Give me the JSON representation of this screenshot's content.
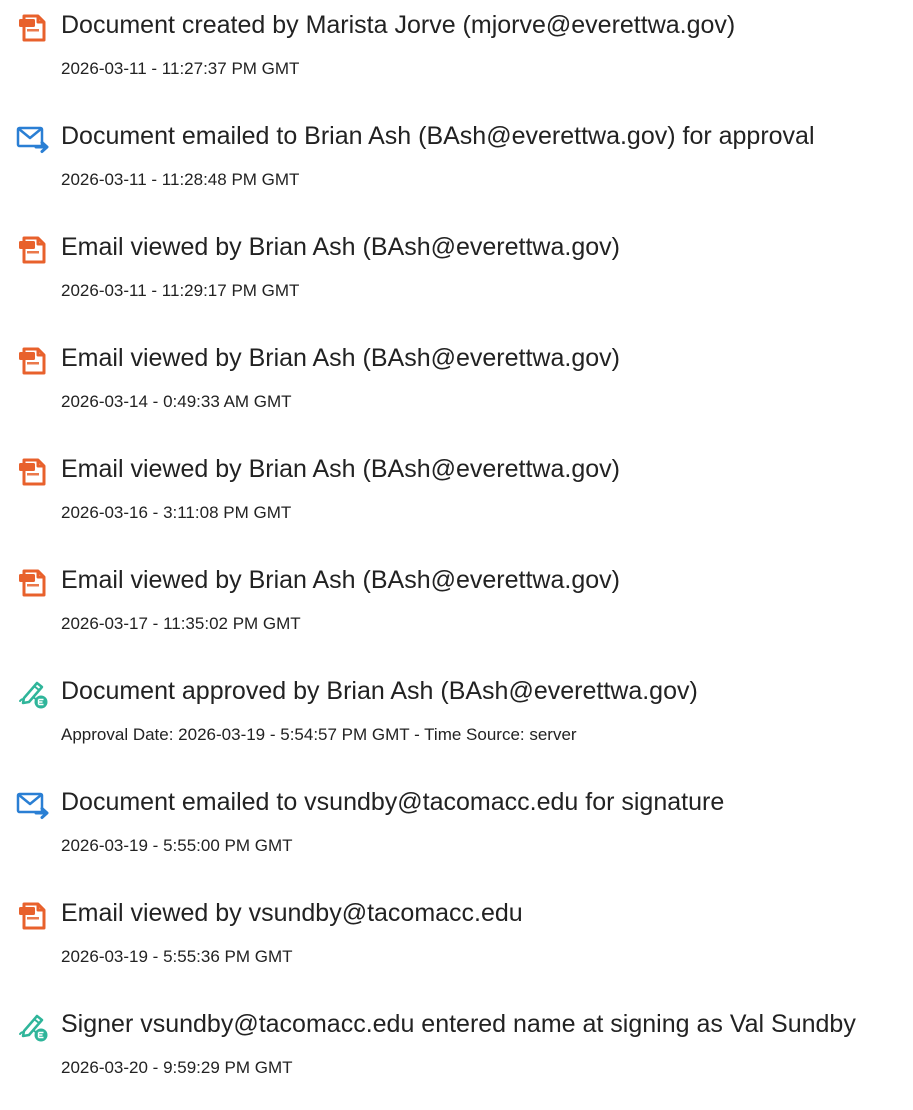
{
  "colors": {
    "document_icon": "#e8612c",
    "email_icon": "#2a7fd4",
    "approve_icon": "#2fb59a",
    "text": "#222222"
  },
  "events": [
    {
      "icon": "document-icon",
      "title": "Document created by Marista Jorve (mjorve@everettwa.gov)",
      "timestamp": "2026-03-11 - 11:27:37 PM GMT"
    },
    {
      "icon": "email-sent-icon",
      "title": "Document emailed to Brian Ash (BAsh@everettwa.gov) for approval",
      "timestamp": "2026-03-11 - 11:28:48 PM GMT"
    },
    {
      "icon": "document-icon",
      "title": "Email viewed by Brian Ash (BAsh@everettwa.gov)",
      "timestamp": "2026-03-11 - 11:29:17 PM GMT"
    },
    {
      "icon": "document-icon",
      "title": "Email viewed by Brian Ash (BAsh@everettwa.gov)",
      "timestamp": "2026-03-14 - 0:49:33 AM GMT"
    },
    {
      "icon": "document-icon",
      "title": "Email viewed by Brian Ash (BAsh@everettwa.gov)",
      "timestamp": "2026-03-16 - 3:11:08 PM GMT"
    },
    {
      "icon": "document-icon",
      "title": "Email viewed by Brian Ash (BAsh@everettwa.gov)",
      "timestamp": "2026-03-17 - 11:35:02 PM GMT"
    },
    {
      "icon": "approve-pen-icon",
      "title": "Document approved by Brian Ash (BAsh@everettwa.gov)",
      "timestamp": "Approval Date: 2026-03-19 - 5:54:57 PM GMT - Time Source: server"
    },
    {
      "icon": "email-sent-icon",
      "title": "Document emailed to vsundby@tacomacc.edu for signature",
      "timestamp": "2026-03-19 - 5:55:00 PM GMT"
    },
    {
      "icon": "document-icon",
      "title": "Email viewed by vsundby@tacomacc.edu",
      "timestamp": "2026-03-19 - 5:55:36 PM GMT"
    },
    {
      "icon": "approve-pen-icon",
      "title": "Signer vsundby@tacomacc.edu entered name at signing as Val Sundby",
      "timestamp": "2026-03-20 - 9:59:29 PM GMT"
    }
  ]
}
